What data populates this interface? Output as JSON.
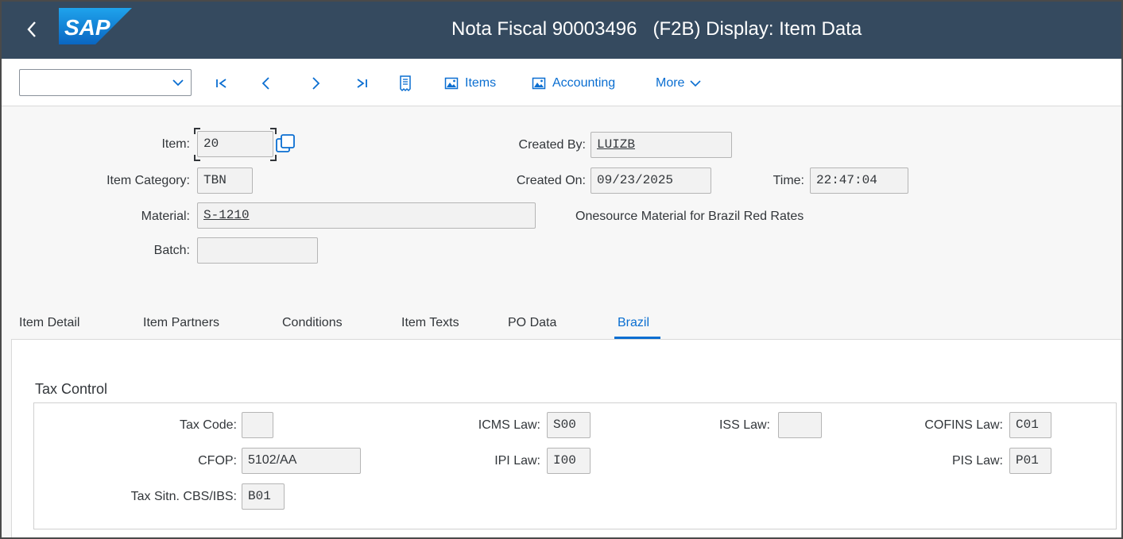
{
  "header": {
    "title": "Nota Fiscal 90003496   (F2B) Display: Item Data",
    "logo_text": "SAP"
  },
  "toolbar": {
    "combo_value": "",
    "items_label": "Items",
    "accounting_label": "Accounting",
    "more_label": "More"
  },
  "form": {
    "item_label": "Item:",
    "item_value": "20",
    "item_category_label": "Item Category:",
    "item_category_value": "TBN",
    "material_label": "Material:",
    "material_value": "S-1210",
    "batch_label": "Batch:",
    "batch_value": "",
    "created_by_label": "Created By:",
    "created_by_value": "LUIZB",
    "created_on_label": "Created On:",
    "created_on_value": "09/23/2025",
    "time_label": "Time:",
    "time_value": "22:47:04",
    "material_description": "Onesource Material for Brazil Red Rates"
  },
  "tabs": [
    {
      "label": "Item Detail",
      "active": false
    },
    {
      "label": "Item Partners",
      "active": false
    },
    {
      "label": "Conditions",
      "active": false
    },
    {
      "label": "Item Texts",
      "active": false
    },
    {
      "label": "PO Data",
      "active": false
    },
    {
      "label": "Brazil",
      "active": true
    }
  ],
  "tax_control": {
    "title": "Tax Control",
    "tax_code_label": "Tax Code:",
    "tax_code_value": "",
    "cfop_label": "CFOP:",
    "cfop_value": "5102/AA",
    "tax_sitn_label": "Tax Sitn. CBS/IBS:",
    "tax_sitn_value": "B01",
    "icms_law_label": "ICMS Law:",
    "icms_law_value": "S00",
    "ipi_law_label": "IPI Law:",
    "ipi_law_value": "I00",
    "iss_law_label": "ISS Law:",
    "iss_law_value": "",
    "cofins_law_label": "COFINS Law:",
    "cofins_law_value": "C01",
    "pis_law_label": "PIS Law:",
    "pis_law_value": "P01"
  },
  "colors": {
    "shell": "#354a5f",
    "accent": "#0a6ed1",
    "field_bg": "#f2f2f2"
  }
}
